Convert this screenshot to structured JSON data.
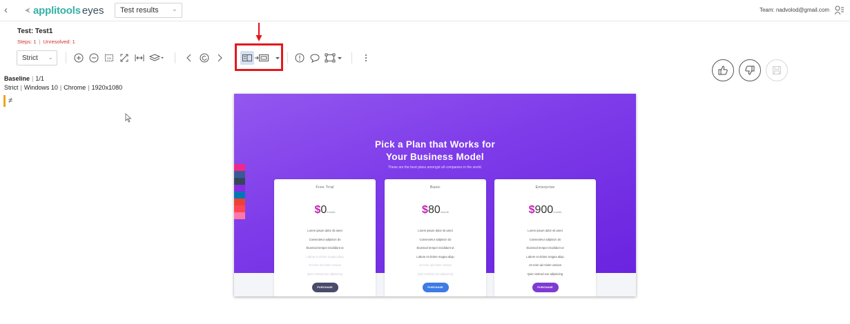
{
  "topbar": {
    "logo_primary": "applitools",
    "logo_secondary": "eyes",
    "view_selector": "Test results",
    "team": "Team: nadvolod@gmail.com"
  },
  "test": {
    "title": "Test: Test1",
    "steps": "Steps: 1",
    "unresolved": "Unresolved: 1",
    "match_level": "Strict"
  },
  "baseline": {
    "label": "Baseline",
    "position": "1/1",
    "env": [
      "Strict",
      "Windows 10",
      "Chrome",
      "1920x1080"
    ],
    "diff_symbol": "≠"
  },
  "screenshot": {
    "title_line1": "Pick a Plan that Works for",
    "title_line2": "Your Business Model",
    "subtitle": "These are the best plans amongst all companies in the world.",
    "cards": [
      {
        "name": "Free Trial",
        "price": "0",
        "per": "/month",
        "features": [
          "Lorem ipsum dolor sit amet",
          "Consectetur adipiscin do",
          "Eiusmod tempor incididunt ut",
          "Labore et dolore magna aliqu",
          "Ut enim ad minim veniam",
          "Quis nostrud exe adipiscing"
        ],
        "active_features": 3,
        "button": "PURCHASE",
        "button_color": "#4a4a6a"
      },
      {
        "name": "Basic",
        "price": "80",
        "per": "/month",
        "features": [
          "Lorem ipsum dolor sit amet",
          "Consectetur adipiscin do",
          "Eiusmod tempor incididunt ut",
          "Labore et dolore magna aliqu",
          "Ut enim ad minim veniam",
          "Quis nostrud exe adipiscing"
        ],
        "active_features": 4,
        "button": "PURCHASE",
        "button_color": "#3d7be5"
      },
      {
        "name": "Enterprise",
        "price": "900",
        "per": "/month",
        "features": [
          "Lorem ipsum dolor sit amet",
          "Consectetur adipiscin do",
          "Eiusmod tempor incididunt ut",
          "Labore et dolore magna aliqu",
          "Ut enim ad minim veniam",
          "Quis nostrud exe adipiscing"
        ],
        "active_features": 6,
        "button": "PURCHASE",
        "button_color": "#7e3bd3"
      }
    ],
    "social_colors": [
      "#f0288a",
      "#3b5998",
      "#35465c",
      "#8a2be2",
      "#0077b5",
      "#ea4335",
      "#f45",
      "#f7a"
    ]
  },
  "colors": {
    "accent": "#35b0a8",
    "highlight": "#e3171d",
    "unresolved": "#d22f2f",
    "diff_marker": "#f1a31e"
  },
  "icons": {
    "toolbar": [
      "zoom-in-icon",
      "zoom-out-icon",
      "actual-size-icon",
      "fit-icon",
      "fit-width-icon",
      "layers-icon",
      "previous-icon",
      "refresh-icon",
      "next-icon",
      "side-by-side-icon",
      "overlay-icon",
      "remark-icon",
      "comment-icon",
      "region-icon",
      "more-icon"
    ],
    "actions": [
      "thumbs-up-icon",
      "thumbs-down-icon",
      "save-icon"
    ]
  }
}
